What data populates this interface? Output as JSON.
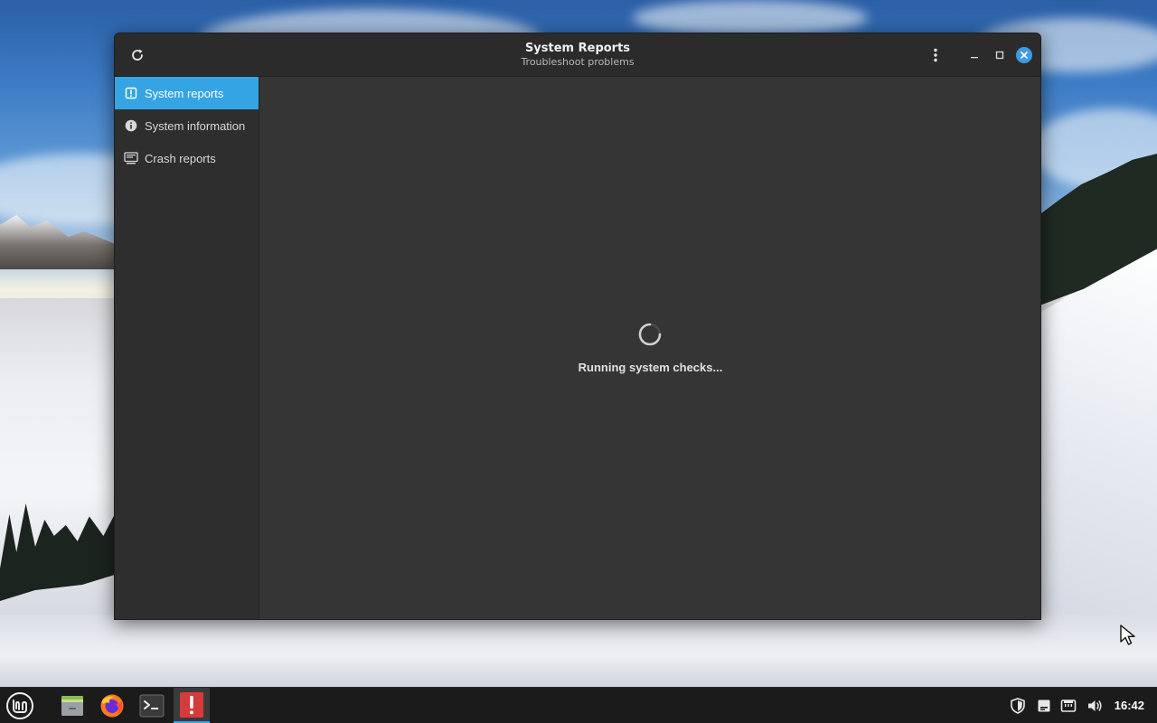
{
  "window": {
    "title": "System Reports",
    "subtitle": "Troubleshoot problems"
  },
  "sidebar": {
    "items": [
      {
        "label": "System reports",
        "icon": "warning-clipboard-icon",
        "active": true
      },
      {
        "label": "System information",
        "icon": "info-icon",
        "active": false
      },
      {
        "label": "Crash reports",
        "icon": "monitor-icon",
        "active": false
      }
    ]
  },
  "content": {
    "status": "Running system checks..."
  },
  "taskbar": {
    "apps": [
      {
        "name": "menu-button",
        "icon": "linux-mint-logo-icon"
      },
      {
        "name": "files",
        "icon": "folder-icon"
      },
      {
        "name": "firefox",
        "icon": "firefox-icon"
      },
      {
        "name": "terminal",
        "icon": "terminal-icon"
      },
      {
        "name": "system-reports",
        "icon": "exclamation-icon",
        "active": true
      }
    ],
    "tray": [
      "shield-icon",
      "notes-icon",
      "network-icon",
      "volume-icon"
    ],
    "clock": "16:42"
  },
  "colors": {
    "accent": "#35a4e4",
    "window_bg": "#353535",
    "headerbar": "#2b2b2b",
    "sidebar": "#2e2e2e",
    "taskbar": "#1b1b1b",
    "alert_red": "#d63b3b"
  }
}
